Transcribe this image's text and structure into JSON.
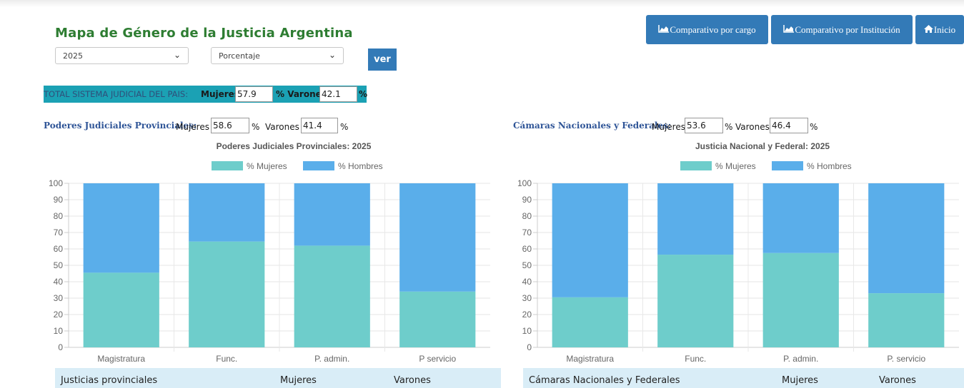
{
  "header": {
    "title": "Mapa de Género de la Justicia Argentina",
    "year_select": "2025",
    "mode_select": "Porcentaje",
    "ver_label": "ver"
  },
  "nav": {
    "cargo_label": "Comparativo por cargo",
    "institucion_label": "Comparativo por Institución",
    "inicio_label": "Inicio"
  },
  "total": {
    "label": "TOTAL SISTEMA JUDICIAL DEL PAIS:",
    "mujeres_label": "Mujeres",
    "mujeres_value": "57.9",
    "varones_label": "% Varones",
    "varones_value": "42.1",
    "pct": "%"
  },
  "left": {
    "section_label": "Poderes Judiciales Provinciales:",
    "mujeres_label": "Mujeres",
    "mujeres_value": "58.6",
    "pct1": "%",
    "varones_label": "Varones",
    "varones_value": "41.4",
    "pct2": "%",
    "table_col1": "Justicias provinciales",
    "table_col2": "Mujeres",
    "table_col3": "Varones"
  },
  "right": {
    "section_label": "Cámaras Nacionales y Federales:",
    "mujeres_label": "Mujeres",
    "mujeres_value": "53.6",
    "pct1": "%",
    "varones_label": "Varones",
    "varones_value": "46.4",
    "pct2": "%",
    "table_col1": "Cámaras Nacionales y Federales",
    "table_col2": "Mujeres",
    "table_col3": "Varones"
  },
  "colors": {
    "mujeres": "#6ecdcb",
    "hombres": "#5aaeea",
    "button": "#337ab7"
  },
  "chart_data": [
    {
      "type": "bar",
      "stacked": true,
      "title": "Poderes Judiciales Provinciales: 2025",
      "categories": [
        "Magistratura",
        "Func.",
        "P. admin.",
        "P servicio"
      ],
      "series": [
        {
          "name": "% Mujeres",
          "values": [
            45.5,
            64.5,
            62,
            34
          ]
        },
        {
          "name": "% Hombres",
          "values": [
            54.5,
            35.5,
            38,
            66
          ]
        }
      ],
      "yticks": [
        "0",
        "10",
        "20",
        "30",
        "40",
        "50",
        "60",
        "70",
        "80",
        "90",
        "100"
      ],
      "ylim": [
        0,
        100
      ],
      "legend": "top"
    },
    {
      "type": "bar",
      "stacked": true,
      "title": "Justicia Nacional y Federal: 2025",
      "categories": [
        "Magistratura",
        "Func.",
        "P. admin.",
        "P. servicio"
      ],
      "series": [
        {
          "name": "% Mujeres",
          "values": [
            30.5,
            56.5,
            57.5,
            33
          ]
        },
        {
          "name": "% Hombres",
          "values": [
            69.5,
            43.5,
            42.5,
            67
          ]
        }
      ],
      "yticks": [
        "0",
        "10",
        "20",
        "30",
        "40",
        "50",
        "60",
        "70",
        "80",
        "90",
        "100"
      ],
      "ylim": [
        0,
        100
      ],
      "legend": "top"
    }
  ]
}
